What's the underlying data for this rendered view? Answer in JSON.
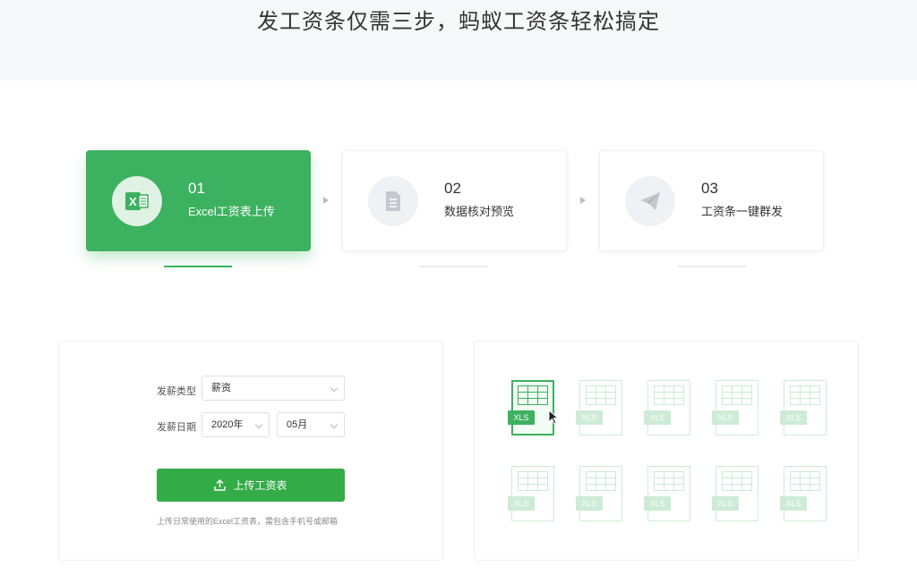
{
  "hero": {
    "title": "发工资条仅需三步，蚂蚁工资条轻松搞定"
  },
  "steps": [
    {
      "num": "01",
      "label": "Excel工资表上传",
      "icon": "excel-icon",
      "active": true
    },
    {
      "num": "02",
      "label": "数据核对预览",
      "icon": "document-icon",
      "active": false
    },
    {
      "num": "03",
      "label": "工资条一键群发",
      "icon": "paper-plane-icon",
      "active": false
    }
  ],
  "form": {
    "type_label": "发薪类型",
    "type_value": "薪资",
    "date_label": "发薪日期",
    "year_value": "2020年",
    "month_value": "05月",
    "upload_label": "上传工资表",
    "hint": "上传日常使用的Excel工资表，需包含手机号或邮箱"
  },
  "files": {
    "tag": "XLS",
    "count": 10
  },
  "colors": {
    "accent": "#3cb15f",
    "button": "#33ab46"
  }
}
